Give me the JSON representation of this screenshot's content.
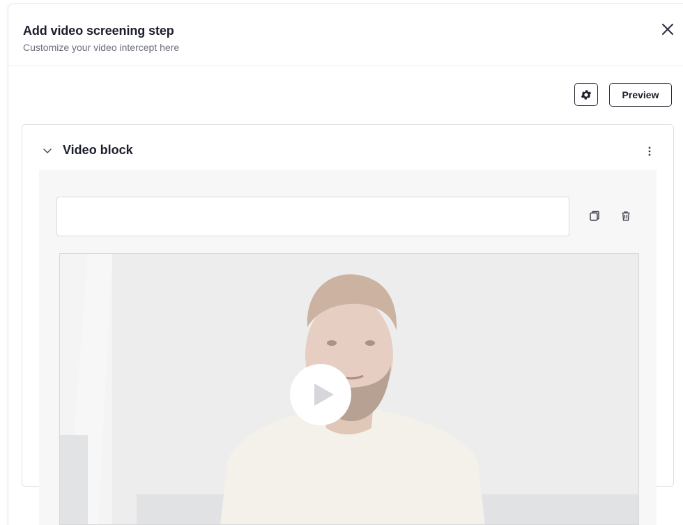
{
  "dialog": {
    "title": "Add video screening step",
    "subtitle": "Customize your video intercept here",
    "close_icon": "close-icon"
  },
  "toolbar": {
    "settings_icon": "gear-icon",
    "preview_label": "Preview"
  },
  "block": {
    "title": "Video block",
    "expand_icon": "chevron-down-icon",
    "menu_icon": "kebab-menu-icon",
    "input_value": "",
    "input_placeholder": "",
    "duplicate_icon": "copy-icon",
    "delete_icon": "trash-icon",
    "video": {
      "play_icon": "play-icon"
    }
  },
  "colors": {
    "text": "#1b1e2b",
    "muted": "#6b6f7b",
    "border": "#dfe0e4",
    "inner_bg": "#f7f7f8"
  }
}
